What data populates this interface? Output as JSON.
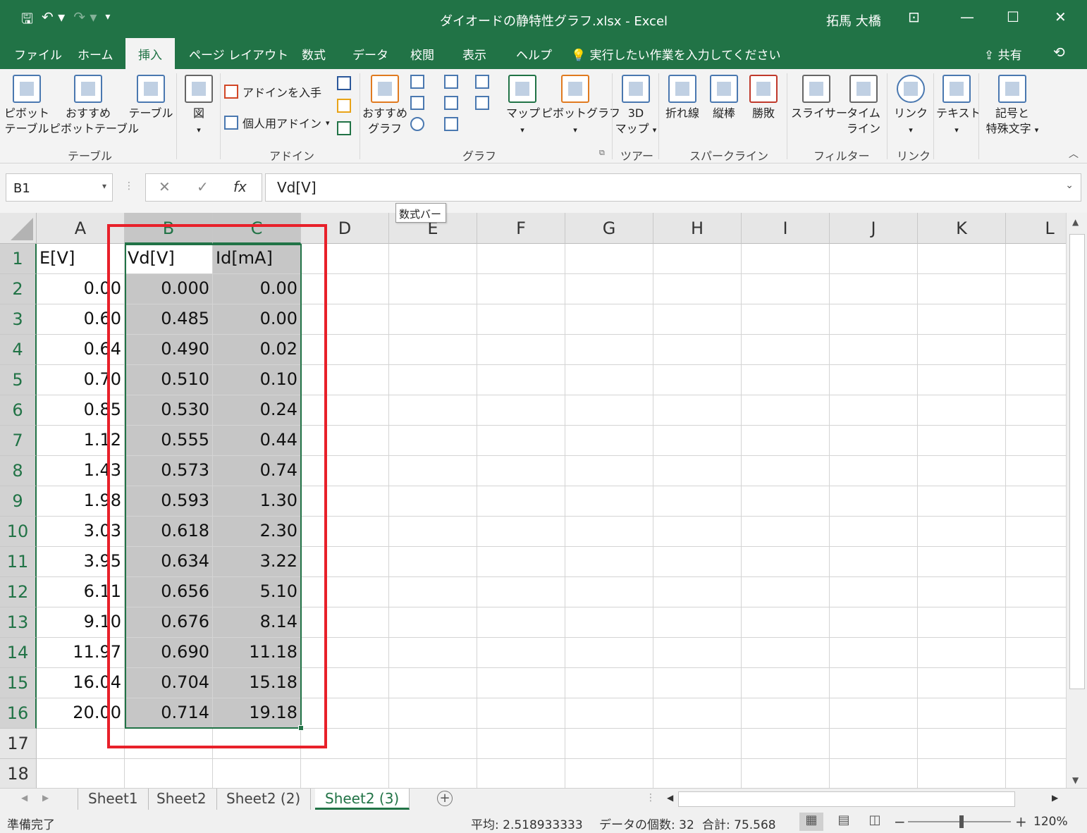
{
  "title": "ダイオードの静特性グラフ.xlsx  -  Excel",
  "user": "拓馬 大橋",
  "tabs": [
    "ファイル",
    "ホーム",
    "挿入",
    "ページ レイアウト",
    "数式",
    "データ",
    "校閲",
    "表示",
    "ヘルプ"
  ],
  "tell_me": "実行したい作業を入力してください",
  "share": "共有",
  "ribbon": {
    "pivot_table": [
      "ピボット",
      "テーブル"
    ],
    "recommended_pivot": [
      "おすすめ",
      "ピボットテーブル"
    ],
    "table": "テーブル",
    "illustrations": "図",
    "get_addins": "アドインを入手",
    "my_addins": "個人用アドイン",
    "recommended_charts": [
      "おすすめ",
      "グラフ"
    ],
    "maps": "マップ",
    "pivot_chart": "ピボットグラフ",
    "map3d": [
      "3D",
      "マップ"
    ],
    "sparkline_line": "折れ線",
    "sparkline_column": "縦棒",
    "sparkline_winloss": "勝敗",
    "slicer": "スライサー",
    "timeline": [
      "タイム",
      "ライン"
    ],
    "link": "リンク",
    "text": "テキスト",
    "symbols": [
      "記号と",
      "特殊文字"
    ],
    "groups": {
      "table": "テーブル",
      "addins": "アドイン",
      "charts": "グラフ",
      "tours": "ツアー",
      "sparklines": "スパークライン",
      "filters": "フィルター",
      "links": "リンク"
    }
  },
  "name_box": "B1",
  "formula": "Vd[V]",
  "tooltip": "数式バー",
  "columns": [
    "A",
    "B",
    "C",
    "D",
    "E",
    "F",
    "G",
    "H",
    "I",
    "J",
    "K",
    "L"
  ],
  "rows": [
    "1",
    "2",
    "3",
    "4",
    "5",
    "6",
    "7",
    "8",
    "9",
    "10",
    "11",
    "12",
    "13",
    "14",
    "15",
    "16",
    "17",
    "18"
  ],
  "sheet": {
    "headers": [
      "E[V]",
      "Vd[V]",
      "Id[mA]"
    ],
    "col_a": [
      "0.00",
      "0.60",
      "0.64",
      "0.70",
      "0.85",
      "1.12",
      "1.43",
      "1.98",
      "3.03",
      "3.95",
      "6.11",
      "9.10",
      "11.97",
      "16.04",
      "20.00"
    ],
    "col_b": [
      "0.000",
      "0.485",
      "0.490",
      "0.510",
      "0.530",
      "0.555",
      "0.573",
      "0.593",
      "0.618",
      "0.634",
      "0.656",
      "0.676",
      "0.690",
      "0.704",
      "0.714"
    ],
    "col_c": [
      "0.00",
      "0.00",
      "0.02",
      "0.10",
      "0.24",
      "0.44",
      "0.74",
      "1.30",
      "2.30",
      "3.22",
      "5.10",
      "8.14",
      "11.18",
      "15.18",
      "19.18"
    ]
  },
  "sheet_tabs": [
    "Sheet1",
    "Sheet2",
    "Sheet2 (2)",
    "Sheet2 (3)"
  ],
  "status": {
    "ready": "準備完了",
    "average": "平均: 2.518933333",
    "count": "データの個数: 32",
    "sum": "合計: 75.568",
    "zoom": "120%"
  },
  "colors": {
    "excel_green": "#217346",
    "highlight_red": "#e8202a",
    "selection_gray": "#c6c6c6"
  }
}
